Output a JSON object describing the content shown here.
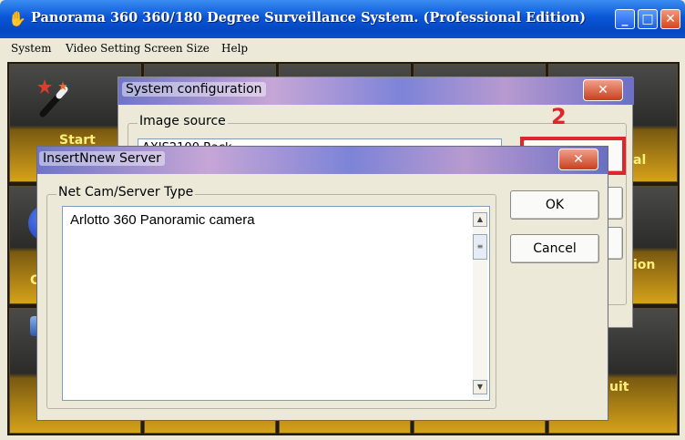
{
  "app": {
    "title": "Panorama 360 360/180 Degree Surveillance System. (Professional Edition)",
    "window_buttons": {
      "minimize": "_",
      "maximize": "□",
      "close": "✕"
    }
  },
  "menu": [
    "System",
    "Video Setting",
    "Screen Size",
    "Help"
  ],
  "tiles": {
    "start_label": "Start",
    "start_fragment": "N",
    "left_middle_fragment": "Co",
    "left_bottom_fragment": "C",
    "right_top_fragment": "al",
    "right_middle_fragment": "ion",
    "right_quit_fragment": "uit"
  },
  "system_config": {
    "title": "System configuration",
    "group_label": "Image source",
    "source_value": "AXIS2100 Rack",
    "close_glyph": "✕"
  },
  "annotation": {
    "label": "2",
    "color": "#e0262a"
  },
  "insert_server": {
    "title": "InsertNnew Server",
    "group_label": "Net Cam/Server Type",
    "options": [
      "Arlotto 360 Panoramic camera"
    ],
    "ok_label": "OK",
    "cancel_label": "Cancel",
    "close_glyph": "✕",
    "scroll_up": "▲",
    "scroll_down": "▼",
    "scroll_thumb": "≡"
  }
}
